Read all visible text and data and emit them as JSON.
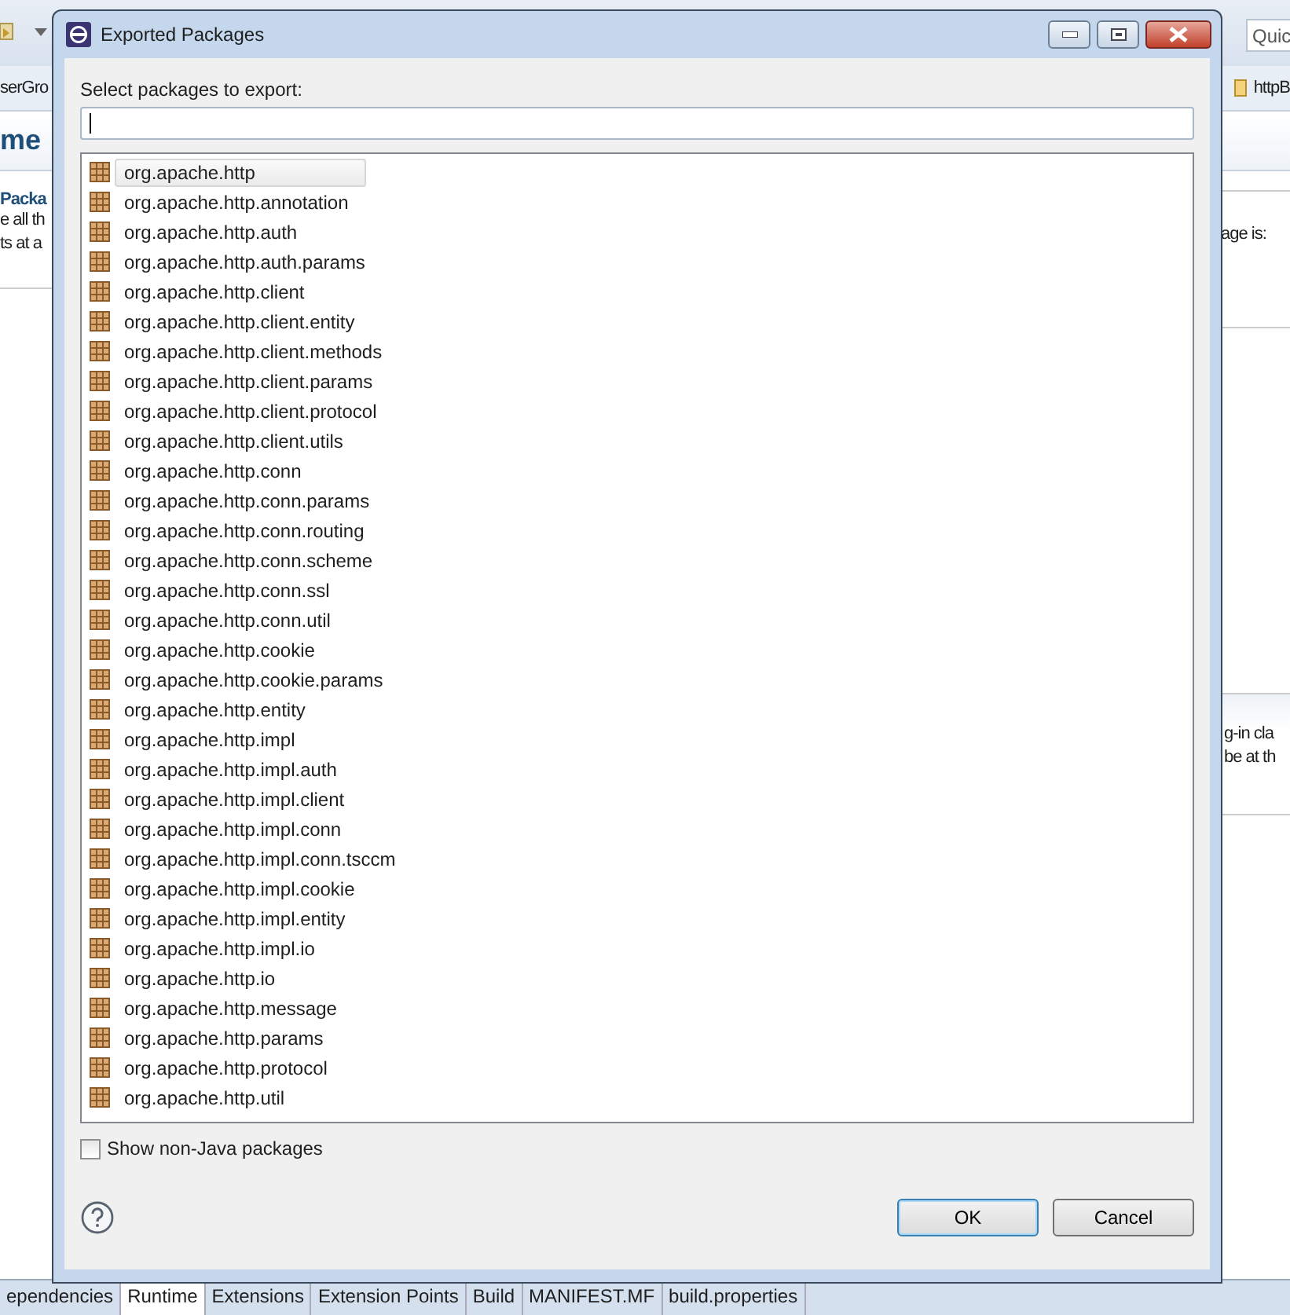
{
  "toolbar": {
    "search_placeholder": "Quic"
  },
  "editor": {
    "breadcrumb_left": "serGro",
    "breadcrumb_right": "httpB",
    "page_title": "me",
    "section_title": "Packa",
    "section_lines": [
      "e all th",
      "ts at a"
    ],
    "right_lines_top": [
      "age is:"
    ],
    "right_lines_bottom": [
      "g-in cla",
      "be at th"
    ]
  },
  "dialog": {
    "title": "Exported Packages",
    "prompt": "Select packages to export:",
    "packages": [
      {
        "name": "org.apache.http",
        "selected": true
      },
      {
        "name": "org.apache.http.annotation",
        "selected": false
      },
      {
        "name": "org.apache.http.auth",
        "selected": false
      },
      {
        "name": "org.apache.http.auth.params",
        "selected": false
      },
      {
        "name": "org.apache.http.client",
        "selected": false
      },
      {
        "name": "org.apache.http.client.entity",
        "selected": false
      },
      {
        "name": "org.apache.http.client.methods",
        "selected": false
      },
      {
        "name": "org.apache.http.client.params",
        "selected": false
      },
      {
        "name": "org.apache.http.client.protocol",
        "selected": false
      },
      {
        "name": "org.apache.http.client.utils",
        "selected": false
      },
      {
        "name": "org.apache.http.conn",
        "selected": false
      },
      {
        "name": "org.apache.http.conn.params",
        "selected": false
      },
      {
        "name": "org.apache.http.conn.routing",
        "selected": false
      },
      {
        "name": "org.apache.http.conn.scheme",
        "selected": false
      },
      {
        "name": "org.apache.http.conn.ssl",
        "selected": false
      },
      {
        "name": "org.apache.http.conn.util",
        "selected": false
      },
      {
        "name": "org.apache.http.cookie",
        "selected": false
      },
      {
        "name": "org.apache.http.cookie.params",
        "selected": false
      },
      {
        "name": "org.apache.http.entity",
        "selected": false
      },
      {
        "name": "org.apache.http.impl",
        "selected": false
      },
      {
        "name": "org.apache.http.impl.auth",
        "selected": false
      },
      {
        "name": "org.apache.http.impl.client",
        "selected": false
      },
      {
        "name": "org.apache.http.impl.conn",
        "selected": false
      },
      {
        "name": "org.apache.http.impl.conn.tsccm",
        "selected": false
      },
      {
        "name": "org.apache.http.impl.cookie",
        "selected": false
      },
      {
        "name": "org.apache.http.impl.entity",
        "selected": false
      },
      {
        "name": "org.apache.http.impl.io",
        "selected": false
      },
      {
        "name": "org.apache.http.io",
        "selected": false
      },
      {
        "name": "org.apache.http.message",
        "selected": false
      },
      {
        "name": "org.apache.http.params",
        "selected": false
      },
      {
        "name": "org.apache.http.protocol",
        "selected": false
      },
      {
        "name": "org.apache.http.util",
        "selected": false
      }
    ],
    "show_non_java": {
      "label": "Show non-Java packages",
      "checked": false
    },
    "buttons": [
      {
        "label": "OK",
        "default": true
      },
      {
        "label": "Cancel",
        "default": false
      }
    ]
  },
  "editor_tabs": [
    {
      "label": "ependencies",
      "selected": false
    },
    {
      "label": "Runtime",
      "selected": true
    },
    {
      "label": "Extensions",
      "selected": false
    },
    {
      "label": "Extension Points",
      "selected": false
    },
    {
      "label": "Build",
      "selected": false
    },
    {
      "label": "MANIFEST.MF",
      "selected": false
    },
    {
      "label": "build.properties",
      "selected": false
    }
  ]
}
